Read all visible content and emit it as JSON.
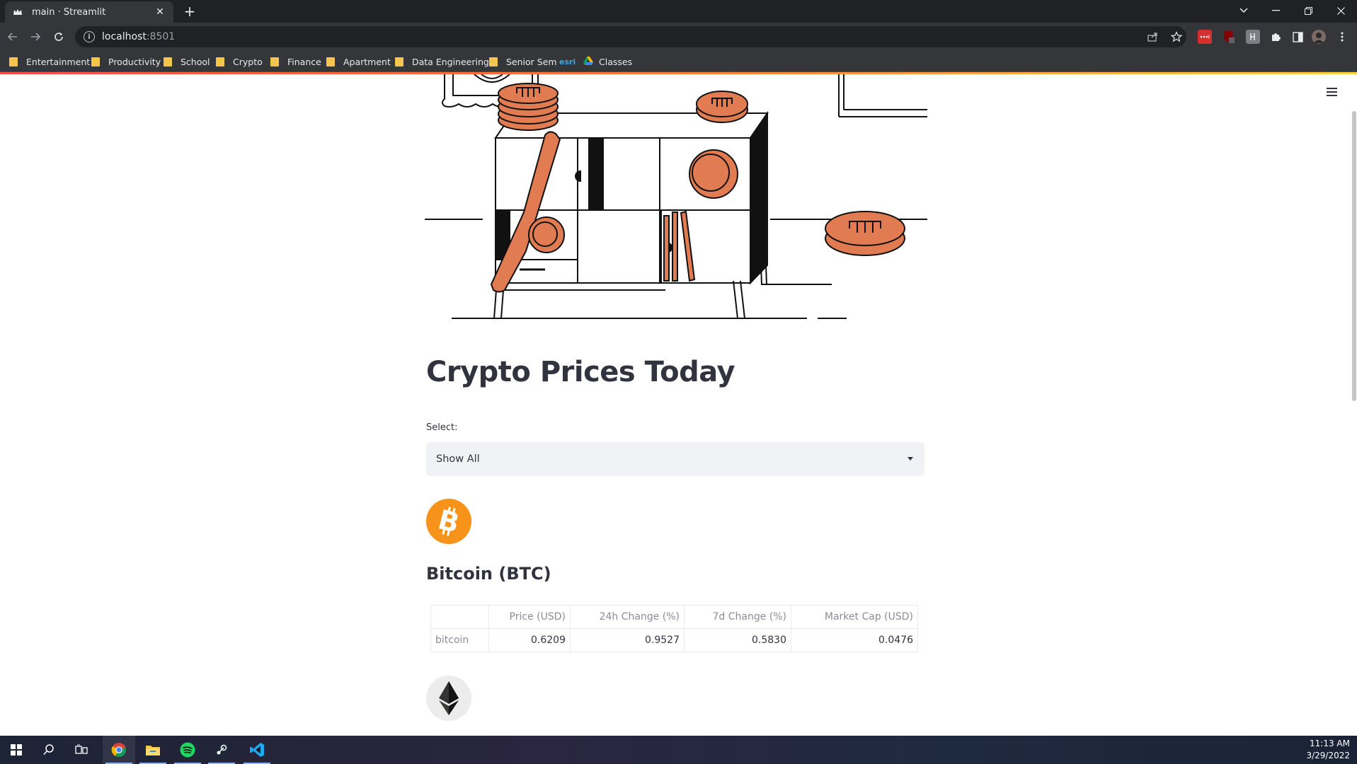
{
  "browser": {
    "tab_title": "main · Streamlit",
    "url_host": "localhost",
    "url_port": ":8501",
    "bookmarks": [
      "Entertainment",
      "Productivity",
      "School",
      "Crypto",
      "Finance",
      "Apartment",
      "Data Engineering",
      "Senior Sem",
      "esri",
      "Classes"
    ]
  },
  "app": {
    "title": "Crypto Prices Today",
    "select_label": "Select:",
    "select_value": "Show All",
    "coin_heading": "Bitcoin (BTC)",
    "table": {
      "columns": [
        "",
        "Price (USD)",
        "24h Change (%)",
        "7d Change (%)",
        "Market Cap (USD)"
      ],
      "rows": [
        {
          "name": "bitcoin",
          "price": "0.6209",
          "change_24h": "0.9527",
          "change_7d": "0.5830",
          "market_cap": "0.0476"
        }
      ]
    }
  },
  "taskbar": {
    "time": "11:13 AM",
    "date": "3/29/2022"
  },
  "colors": {
    "accent_orange": "#e07b52",
    "btc_orange": "#f7931a",
    "text_dark": "#31333f"
  }
}
